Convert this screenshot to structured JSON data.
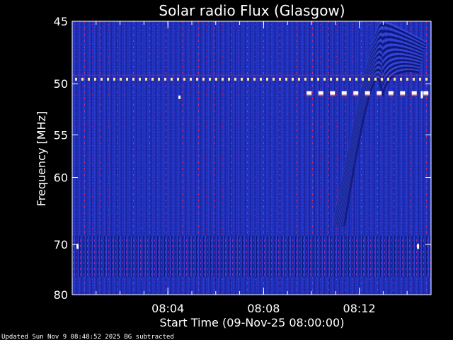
{
  "chart_data": {
    "type": "heatmap",
    "title": "Solar radio Flux (Glasgow)",
    "xlabel": "Start Time (09-Nov-25 08:00:00)",
    "ylabel": "Frequency [MHz]",
    "x_range_minutes": [
      0,
      15
    ],
    "x_ticks": [
      {
        "minute": 4,
        "label": "08:04"
      },
      {
        "minute": 8,
        "label": "08:08"
      },
      {
        "minute": 12,
        "label": "08:12"
      }
    ],
    "ylim_mhz": [
      45,
      80
    ],
    "y_scale": "reciprocal",
    "y_ticks": [
      {
        "mhz": 45,
        "label": "45"
      },
      {
        "mhz": 50,
        "label": "50"
      },
      {
        "mhz": 55,
        "label": "55"
      },
      {
        "mhz": 60,
        "label": "60"
      },
      {
        "mhz": 70,
        "label": "70"
      },
      {
        "mhz": 80,
        "label": "80"
      }
    ],
    "colormap": {
      "background": "#1c2bb0",
      "dark": "#0a1266",
      "hot": "#ff3030",
      "max": "#ffffff"
    },
    "interference_lines": [
      {
        "mhz": 49.6,
        "from_min": 0,
        "to_min": 15,
        "color": "#ffe2a0"
      },
      {
        "mhz": 50.8,
        "from_min": 9.8,
        "to_min": 14.7,
        "color": "#ffffff"
      }
    ],
    "features": [
      {
        "name": "arch-pattern",
        "from_min": 10.9,
        "to_min": 14.8,
        "from_mhz": 45,
        "to_mhz": 67
      }
    ],
    "footer": "Updated Sun Nov  9 08:48:52 2025   BG subtracted"
  }
}
